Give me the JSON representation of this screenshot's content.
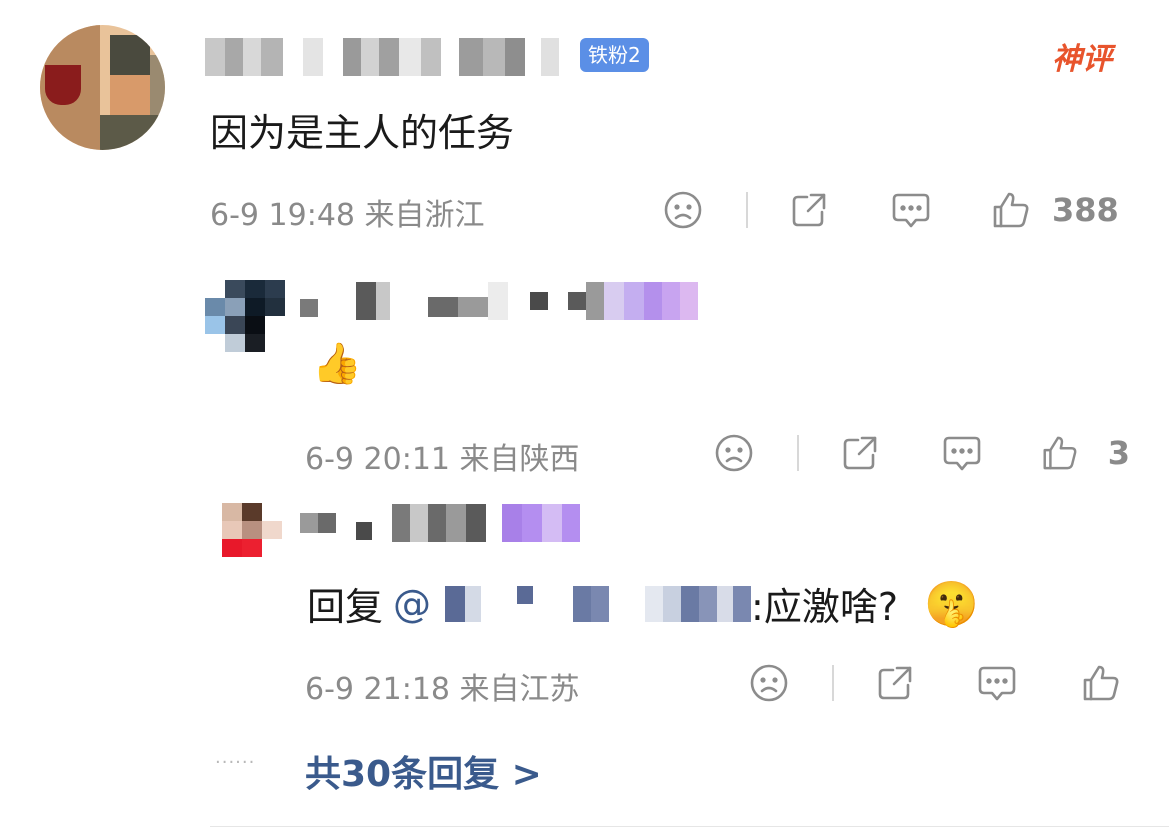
{
  "comment": {
    "badge": "铁粉2",
    "shenping": "神评",
    "text": "因为是主人的任务",
    "date": "6-9 19:48",
    "location": "来自浙江",
    "likes": "388"
  },
  "reply1": {
    "text": "👍",
    "date": "6-9 20:11",
    "location": "来自陕西",
    "likes": "3"
  },
  "reply2": {
    "prefix": "回复",
    "mention": "@",
    "suffix": ":应激啥?",
    "emoji": "🤫",
    "date": "6-9 21:18",
    "location": "来自江苏"
  },
  "more": {
    "dots": "······",
    "label": "共30条回复 >"
  },
  "colors": {
    "meta": "#8a8a8a",
    "link": "#3a5a8c",
    "badge": "#5b8fe6",
    "shenping": "#e8542c"
  }
}
